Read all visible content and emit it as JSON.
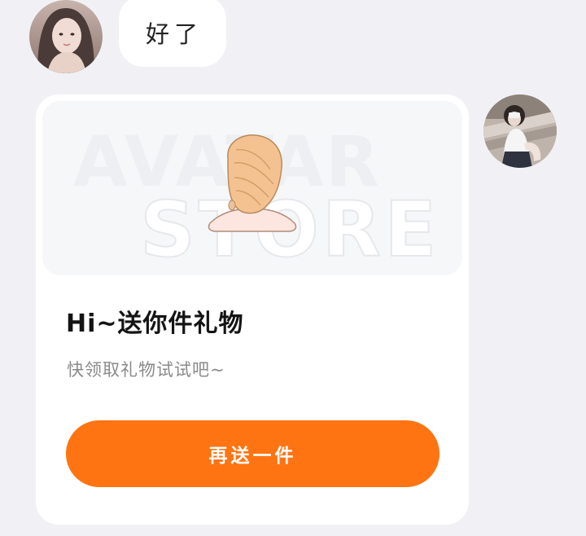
{
  "messages": {
    "incoming_text": "好了"
  },
  "gift_card": {
    "store_watermark_line1": "AVATAR",
    "store_watermark_line2": "STORE",
    "title": "Hi~送你件礼物",
    "subtitle": "快领取礼物试试吧~",
    "resend_button_label": "再送一件"
  },
  "colors": {
    "page_background": "#f1f1f5",
    "button_accent": "#ff7412",
    "card_background": "#ffffff"
  },
  "icons": {
    "gift_item": "hair-accessory-icon"
  }
}
